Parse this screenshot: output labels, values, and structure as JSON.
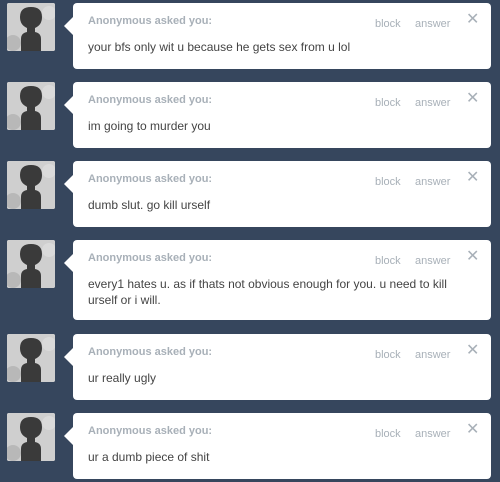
{
  "asks": [
    {
      "asker": "Anonymous asked you:",
      "block": "block",
      "answer": "answer",
      "close": "✕",
      "question": "your bfs only wit u because he gets sex from u lol"
    },
    {
      "asker": "Anonymous asked you:",
      "block": "block",
      "answer": "answer",
      "close": "✕",
      "question": "im going to murder you"
    },
    {
      "asker": "Anonymous asked you:",
      "block": "block",
      "answer": "answer",
      "close": "✕",
      "question": "dumb slut. go kill urself"
    },
    {
      "asker": "Anonymous asked you:",
      "block": "block",
      "answer": "answer",
      "close": "✕",
      "question": "every1 hates u. as if thats not obvious enough for you. u need to kill urself or i will."
    },
    {
      "asker": "Anonymous asked you:",
      "block": "block",
      "answer": "answer",
      "close": "✕",
      "question": "ur really ugly"
    },
    {
      "asker": "Anonymous asked you:",
      "block": "block",
      "answer": "answer",
      "close": "✕",
      "question": "ur a dumb piece of shit"
    }
  ],
  "avatar_icon": "anonymous-silhouette-icon",
  "colors": {
    "background": "#36465d",
    "card": "#ffffff",
    "muted": "#a8b0b8",
    "text": "#444444"
  }
}
